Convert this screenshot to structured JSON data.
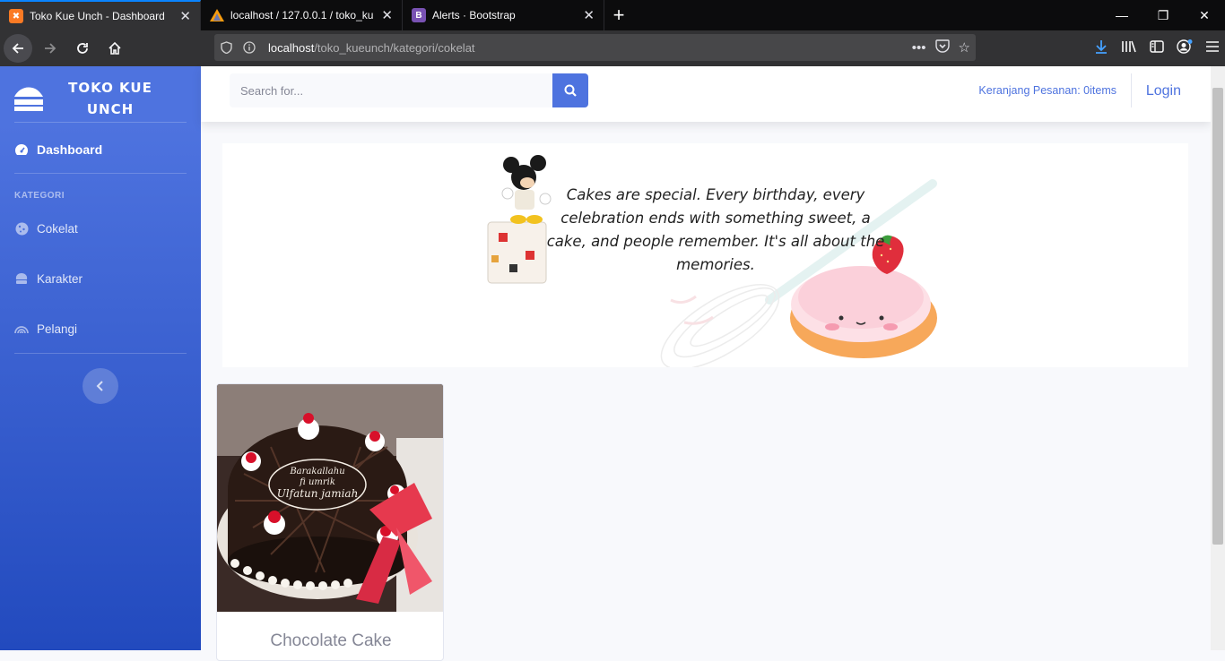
{
  "browser": {
    "tabs": [
      {
        "title": "Toko Kue Unch - Dashboard",
        "favicon": "xampp-icon",
        "active": true
      },
      {
        "title": "localhost / 127.0.0.1 / toko_kue",
        "favicon": "phpmyadmin-icon",
        "active": false
      },
      {
        "title": "Alerts · Bootstrap",
        "favicon": "bootstrap-icon",
        "active": false
      }
    ],
    "url_host": "localhost",
    "url_path": "/toko_kueunch/kategori/cokelat",
    "accent": "#0a84ff"
  },
  "sidebar": {
    "brand": "TOKO KUE UNCH",
    "dashboard_label": "Dashboard",
    "heading": "KATEGORI",
    "items": [
      {
        "label": "Cokelat",
        "icon": "cookie-icon"
      },
      {
        "label": "Karakter",
        "icon": "hat-icon"
      },
      {
        "label": "Pelangi",
        "icon": "rainbow-icon"
      }
    ],
    "gradient_start": "#4e73df",
    "gradient_end": "#224abe"
  },
  "topbar": {
    "search_placeholder": "Search for...",
    "cart_text": "Keranjang Pesanan: 0items",
    "login_label": "Login"
  },
  "banner": {
    "quote": "Cakes are special. Every birthday, every celebration ends with something sweet, a cake, and people remember. It's all about the memories."
  },
  "products": [
    {
      "title": "Chocolate Cake",
      "cake_text": "Barakallahu fi umrik Ulfatun jamiah"
    }
  ]
}
